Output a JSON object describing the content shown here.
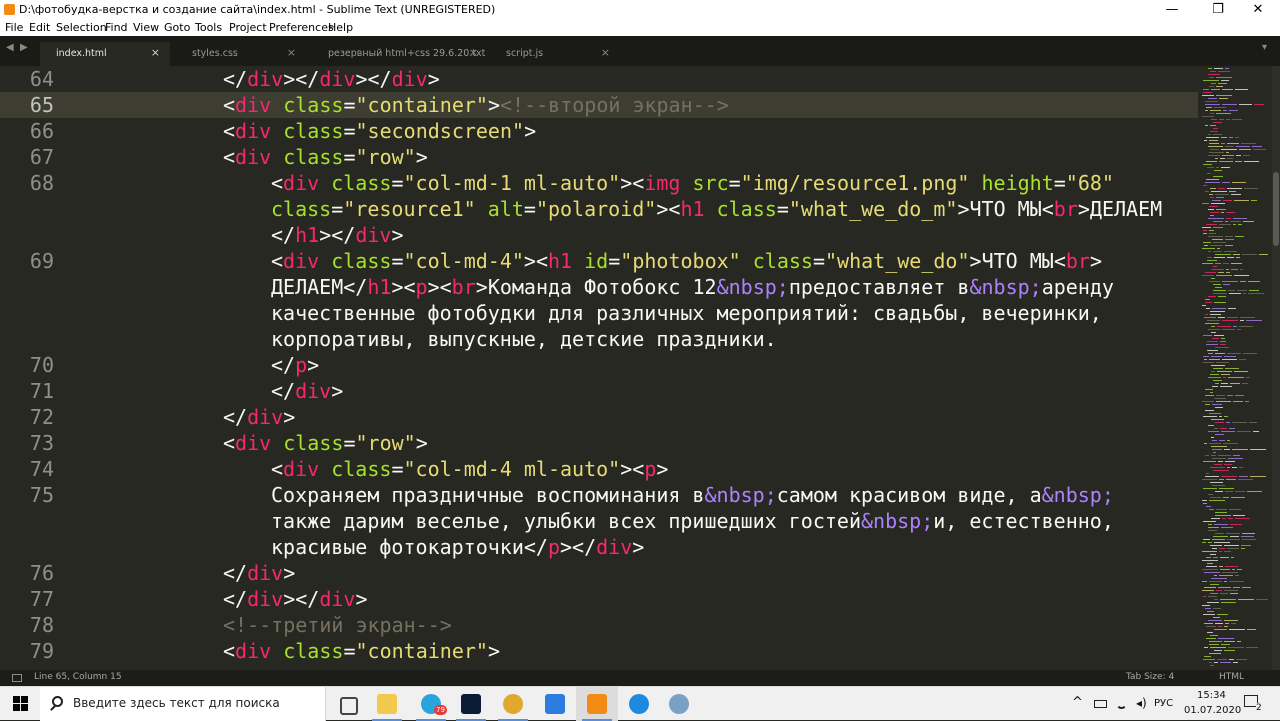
{
  "window": {
    "title": "D:\\фотобудка-верстка и создание сайта\\index.html - Sublime Text (UNREGISTERED)",
    "minimize": "—",
    "maximize": "❐",
    "close": "✕"
  },
  "menu": [
    "File",
    "Edit",
    "Selection",
    "Find",
    "View",
    "Goto",
    "Tools",
    "Project",
    "Preferences",
    "Help"
  ],
  "tabs": [
    {
      "label": "index.html",
      "active": true
    },
    {
      "label": "styles.css",
      "active": false
    },
    {
      "label": "резервный html+css 29.6.20.txt",
      "active": false
    },
    {
      "label": "script.js",
      "active": false
    }
  ],
  "tab_close": "×",
  "tab_nav": {
    "left": "◀",
    "right": "▶",
    "more": "▾"
  },
  "editor": {
    "current_line": 65,
    "lines": [
      {
        "num": "64",
        "indent": 4,
        "tokens": [
          [
            "pun",
            "</"
          ],
          [
            "tag",
            "div"
          ],
          [
            "pun",
            "></"
          ],
          [
            "tag",
            "div"
          ],
          [
            "pun",
            "></"
          ],
          [
            "tag",
            "div"
          ],
          [
            "pun",
            ">"
          ]
        ]
      },
      {
        "num": "65",
        "indent": 4,
        "tokens": [
          [
            "pun",
            "<"
          ],
          [
            "tag",
            "div"
          ],
          [
            "pun",
            " "
          ],
          [
            "attr",
            "class"
          ],
          [
            "pun",
            "="
          ],
          [
            "str",
            "\"container\""
          ],
          [
            "pun",
            ">"
          ],
          [
            "cmt",
            "<!--второй экран-->"
          ]
        ]
      },
      {
        "num": "66",
        "indent": 4,
        "tokens": [
          [
            "pun",
            "<"
          ],
          [
            "tag",
            "div"
          ],
          [
            "pun",
            " "
          ],
          [
            "attr",
            "class"
          ],
          [
            "pun",
            "="
          ],
          [
            "str",
            "\"secondscreen\""
          ],
          [
            "pun",
            ">"
          ]
        ]
      },
      {
        "num": "67",
        "indent": 4,
        "tokens": [
          [
            "pun",
            "<"
          ],
          [
            "tag",
            "div"
          ],
          [
            "pun",
            " "
          ],
          [
            "attr",
            "class"
          ],
          [
            "pun",
            "="
          ],
          [
            "str",
            "\"row\""
          ],
          [
            "pun",
            ">"
          ]
        ]
      },
      {
        "num": "68",
        "indent": 5,
        "tokens": [
          [
            "pun",
            "<"
          ],
          [
            "tag",
            "div"
          ],
          [
            "pun",
            " "
          ],
          [
            "attr",
            "class"
          ],
          [
            "pun",
            "="
          ],
          [
            "str",
            "\"col-md-1 ml-auto\""
          ],
          [
            "pun",
            "><"
          ],
          [
            "tag",
            "img"
          ],
          [
            "pun",
            " "
          ],
          [
            "attr",
            "src"
          ],
          [
            "pun",
            "="
          ],
          [
            "str",
            "\"img/resource1.png\""
          ],
          [
            "pun",
            " "
          ],
          [
            "attr",
            "height"
          ],
          [
            "pun",
            "="
          ],
          [
            "str",
            "\"68\""
          ]
        ]
      },
      {
        "num": "",
        "indent": 5,
        "tokens": [
          [
            "attr",
            "class"
          ],
          [
            "pun",
            "="
          ],
          [
            "str",
            "\"resource1\""
          ],
          [
            "pun",
            " "
          ],
          [
            "attr",
            "alt"
          ],
          [
            "pun",
            "="
          ],
          [
            "str",
            "\"polaroid\""
          ],
          [
            "pun",
            "><"
          ],
          [
            "tag",
            "h1"
          ],
          [
            "pun",
            " "
          ],
          [
            "attr",
            "class"
          ],
          [
            "pun",
            "="
          ],
          [
            "str",
            "\"what_we_do_m\""
          ],
          [
            "pun",
            ">"
          ],
          [
            "txt",
            "ЧТО МЫ"
          ],
          [
            "pun",
            "<"
          ],
          [
            "tag",
            "br"
          ],
          [
            "pun",
            ">"
          ],
          [
            "txt",
            "ДЕЛАЕМ"
          ]
        ]
      },
      {
        "num": "",
        "indent": 5,
        "tokens": [
          [
            "pun",
            "</"
          ],
          [
            "tag",
            "h1"
          ],
          [
            "pun",
            "></"
          ],
          [
            "tag",
            "div"
          ],
          [
            "pun",
            ">"
          ]
        ]
      },
      {
        "num": "69",
        "indent": 5,
        "tokens": [
          [
            "pun",
            "<"
          ],
          [
            "tag",
            "div"
          ],
          [
            "pun",
            " "
          ],
          [
            "attr",
            "class"
          ],
          [
            "pun",
            "="
          ],
          [
            "str",
            "\"col-md-4\""
          ],
          [
            "pun",
            "><"
          ],
          [
            "tag",
            "h1"
          ],
          [
            "pun",
            " "
          ],
          [
            "attr",
            "id"
          ],
          [
            "pun",
            "="
          ],
          [
            "str",
            "\"photobox\""
          ],
          [
            "pun",
            " "
          ],
          [
            "attr",
            "class"
          ],
          [
            "pun",
            "="
          ],
          [
            "str",
            "\"what_we_do\""
          ],
          [
            "pun",
            ">"
          ],
          [
            "txt",
            "ЧТО МЫ"
          ],
          [
            "pun",
            "<"
          ],
          [
            "tag",
            "br"
          ],
          [
            "pun",
            ">"
          ]
        ]
      },
      {
        "num": "",
        "indent": 5,
        "tokens": [
          [
            "txt",
            "ДЕЛАЕМ"
          ],
          [
            "pun",
            "</"
          ],
          [
            "tag",
            "h1"
          ],
          [
            "pun",
            "><"
          ],
          [
            "tag",
            "p"
          ],
          [
            "pun",
            "><"
          ],
          [
            "tag",
            "br"
          ],
          [
            "pun",
            ">"
          ],
          [
            "txt",
            "Команда Фотобокс 12"
          ],
          [
            "ent",
            "&nbsp;"
          ],
          [
            "txt",
            "предоставляет в"
          ],
          [
            "ent",
            "&nbsp;"
          ],
          [
            "txt",
            "аренду"
          ]
        ]
      },
      {
        "num": "",
        "indent": 5,
        "tokens": [
          [
            "txt",
            "качественные фотобудки для различных мероприятий: свадьбы, вечеринки,"
          ]
        ]
      },
      {
        "num": "",
        "indent": 5,
        "tokens": [
          [
            "txt",
            "корпоративы, выпускные, детские праздники."
          ]
        ]
      },
      {
        "num": "70",
        "indent": 5,
        "tokens": [
          [
            "pun",
            "</"
          ],
          [
            "tag",
            "p"
          ],
          [
            "pun",
            ">"
          ]
        ]
      },
      {
        "num": "71",
        "indent": 5,
        "tokens": [
          [
            "pun",
            "</"
          ],
          [
            "tag",
            "div"
          ],
          [
            "pun",
            ">"
          ]
        ]
      },
      {
        "num": "72",
        "indent": 4,
        "tokens": [
          [
            "pun",
            "</"
          ],
          [
            "tag",
            "div"
          ],
          [
            "pun",
            ">"
          ]
        ]
      },
      {
        "num": "73",
        "indent": 4,
        "tokens": [
          [
            "pun",
            "<"
          ],
          [
            "tag",
            "div"
          ],
          [
            "pun",
            " "
          ],
          [
            "attr",
            "class"
          ],
          [
            "pun",
            "="
          ],
          [
            "str",
            "\"row\""
          ],
          [
            "pun",
            ">"
          ]
        ]
      },
      {
        "num": "74",
        "indent": 5,
        "tokens": [
          [
            "pun",
            "<"
          ],
          [
            "tag",
            "div"
          ],
          [
            "pun",
            " "
          ],
          [
            "attr",
            "class"
          ],
          [
            "pun",
            "="
          ],
          [
            "str",
            "\"col-md-4 ml-auto\""
          ],
          [
            "pun",
            "><"
          ],
          [
            "tag",
            "p"
          ],
          [
            "pun",
            ">"
          ]
        ]
      },
      {
        "num": "75",
        "indent": 5,
        "tokens": [
          [
            "txt",
            "Сохраняем праздничные воспоминания в"
          ],
          [
            "ent",
            "&nbsp;"
          ],
          [
            "txt",
            "самом красивом виде, а"
          ],
          [
            "ent",
            "&nbsp;"
          ]
        ]
      },
      {
        "num": "",
        "indent": 5,
        "tokens": [
          [
            "txt",
            "также дарим веселье, улыбки всех пришедших гостей"
          ],
          [
            "ent",
            "&nbsp;"
          ],
          [
            "txt",
            "и, естественно,"
          ]
        ]
      },
      {
        "num": "",
        "indent": 5,
        "tokens": [
          [
            "txt",
            "красивые фотокарточки"
          ],
          [
            "pun",
            "</"
          ],
          [
            "tag",
            "p"
          ],
          [
            "pun",
            "></"
          ],
          [
            "tag",
            "div"
          ],
          [
            "pun",
            ">"
          ]
        ]
      },
      {
        "num": "76",
        "indent": 4,
        "tokens": [
          [
            "pun",
            "</"
          ],
          [
            "tag",
            "div"
          ],
          [
            "pun",
            ">"
          ]
        ]
      },
      {
        "num": "77",
        "indent": 4,
        "tokens": [
          [
            "pun",
            "</"
          ],
          [
            "tag",
            "div"
          ],
          [
            "pun",
            "></"
          ],
          [
            "tag",
            "div"
          ],
          [
            "pun",
            ">"
          ]
        ]
      },
      {
        "num": "78",
        "indent": 4,
        "tokens": [
          [
            "cmt",
            "<!--третий экран-->"
          ]
        ]
      },
      {
        "num": "79",
        "indent": 4,
        "tokens": [
          [
            "pun",
            "<"
          ],
          [
            "tag",
            "div"
          ],
          [
            "pun",
            " "
          ],
          [
            "attr",
            "class"
          ],
          [
            "pun",
            "="
          ],
          [
            "str",
            "\"container\""
          ],
          [
            "pun",
            ">"
          ]
        ]
      }
    ]
  },
  "status": {
    "position": "Line 65, Column 15",
    "tab_size": "Tab Size: 4",
    "syntax": "HTML"
  },
  "taskbar": {
    "search_placeholder": "Введите здесь текст для поиска",
    "apps": [
      {
        "icon": "task-view-icon",
        "color": "#444444"
      },
      {
        "icon": "file-explorer-icon",
        "color": "#f2c94c"
      },
      {
        "icon": "telegram-icon",
        "color": "#2aa3df",
        "badge": "79"
      },
      {
        "icon": "photoshop-icon",
        "color": "#0b1d36"
      },
      {
        "icon": "chrome-icon",
        "color": "#e2a72e"
      },
      {
        "icon": "tasks-check-icon",
        "color": "#2d7de0"
      },
      {
        "icon": "sublime-text-icon",
        "color": "#f28b13"
      },
      {
        "icon": "internet-explorer-icon",
        "color": "#1d8ae0"
      },
      {
        "icon": "media-app-icon",
        "color": "#7aa0c4"
      }
    ],
    "tray": {
      "chevron": "^",
      "lang": "РУС",
      "time": "15:34",
      "date": "01.07.2020",
      "notifications": "2"
    }
  }
}
